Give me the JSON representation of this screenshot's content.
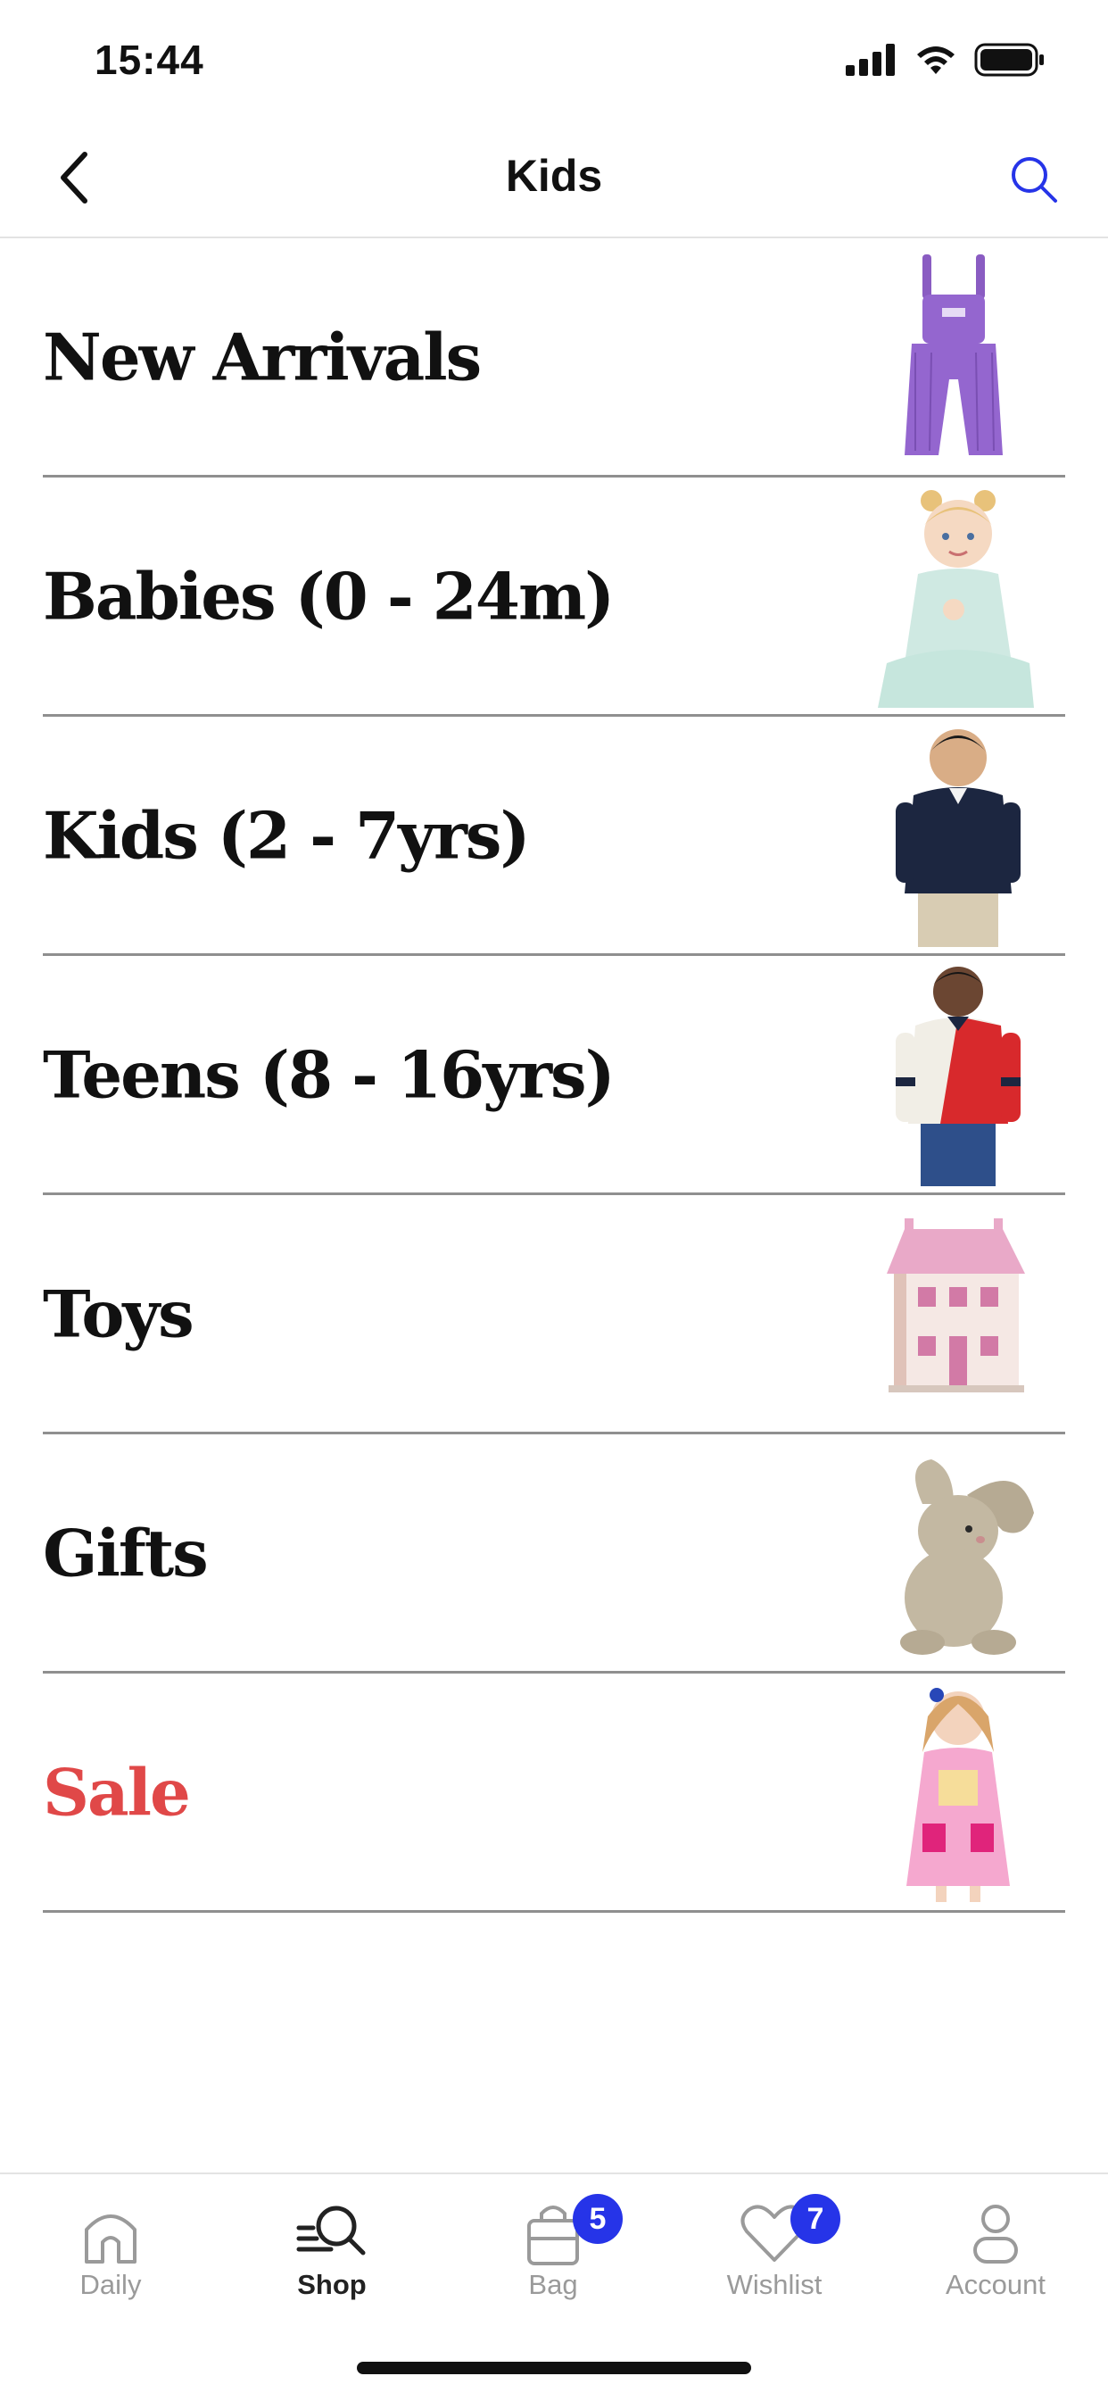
{
  "status_bar": {
    "time": "15:44"
  },
  "header": {
    "title": "Kids"
  },
  "categories": [
    {
      "label": "New Arrivals",
      "image": "purple-corduroy-overalls",
      "sale": false
    },
    {
      "label": "Babies (0 - 24m)",
      "image": "baby-in-mint-sleepsuit",
      "sale": false
    },
    {
      "label": "Kids (2 - 7yrs)",
      "image": "boy-in-navy-shirt",
      "sale": false
    },
    {
      "label": "Teens (8 - 16yrs)",
      "image": "boy-in-red-rugby-shirt",
      "sale": false
    },
    {
      "label": "Toys",
      "image": "pink-dollhouse",
      "sale": false
    },
    {
      "label": "Gifts",
      "image": "plush-bunny",
      "sale": false
    },
    {
      "label": "Sale",
      "image": "girl-in-pink-dress",
      "sale": true
    }
  ],
  "tab_bar": {
    "tabs": [
      {
        "label": "Daily",
        "icon": "home-icon",
        "active": false
      },
      {
        "label": "Shop",
        "icon": "shop-search-icon",
        "active": true
      },
      {
        "label": "Bag",
        "icon": "bag-icon",
        "active": false,
        "badge": "5"
      },
      {
        "label": "Wishlist",
        "icon": "heart-icon",
        "active": false,
        "badge": "7"
      },
      {
        "label": "Account",
        "icon": "account-icon",
        "active": false
      }
    ]
  },
  "colors": {
    "accent": "#2634e8",
    "sale": "#e04848",
    "divider": "#8f8f8f"
  }
}
